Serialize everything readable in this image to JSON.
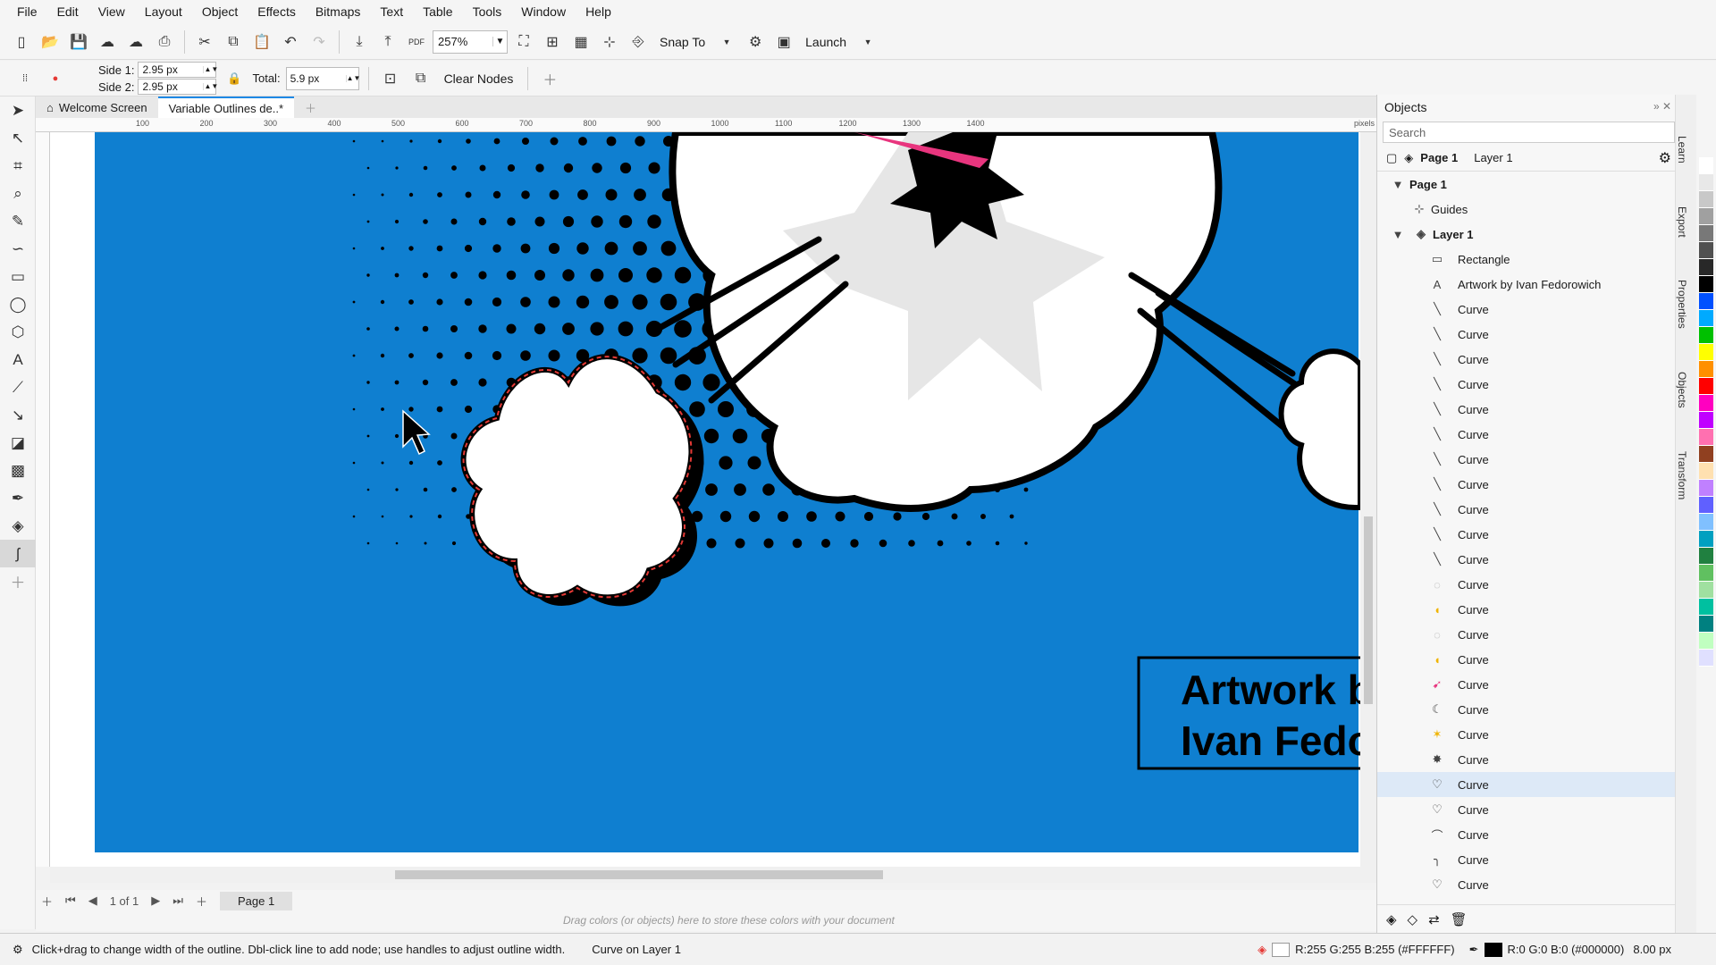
{
  "menu": [
    "File",
    "Edit",
    "View",
    "Layout",
    "Object",
    "Effects",
    "Bitmaps",
    "Text",
    "Table",
    "Tools",
    "Window",
    "Help"
  ],
  "toolbar": {
    "zoom": "257%",
    "snap_to": "Snap To",
    "launch": "Launch"
  },
  "property_bar": {
    "side1_label": "Side 1:",
    "side1_value": "2.95 px",
    "side2_label": "Side 2:",
    "side2_value": "2.95 px",
    "total_label": "Total:",
    "total_value": "5.9 px",
    "clear_nodes": "Clear Nodes"
  },
  "doc_tabs": [
    "Welcome Screen",
    "Variable Outlines de..*"
  ],
  "ruler": {
    "h_ticks": [
      "100",
      "200",
      "300",
      "400",
      "500",
      "600",
      "700",
      "800",
      "900",
      "1000",
      "1100",
      "1200",
      "1300",
      "1400"
    ],
    "units": "pixels"
  },
  "canvas": {
    "artwork_line1": "Artwork by",
    "artwork_line2": "Ivan Fedoro"
  },
  "page_nav": {
    "page_count": "1 of 1",
    "page_tab": "Page 1"
  },
  "color_tray_hint": "Drag colors (or objects) here to store these colors with your document",
  "status": {
    "hint": "Click+drag to change width of the outline. Dbl-click line to add node; use handles to adjust outline width.",
    "selection": "Curve on Layer 1",
    "fill": "R:255 G:255 B:255 (#FFFFFF)",
    "outline": "R:0 G:0 B:0 (#000000)",
    "outline_width": "8.00 px"
  },
  "objects_panel": {
    "title": "Objects",
    "search_placeholder": "Search",
    "page_label": "Page 1",
    "layer_label": "Layer 1",
    "tree_page": "Page 1",
    "guides": "Guides",
    "layer": "Layer 1",
    "items": [
      {
        "icon": "rectangle-icon",
        "label": "Rectangle"
      },
      {
        "icon": "text-icon",
        "label": "Artwork by  Ivan Fedorowich"
      },
      {
        "icon": "curve-line-icon",
        "label": "Curve"
      },
      {
        "icon": "curve-line-icon",
        "label": "Curve"
      },
      {
        "icon": "curve-line-icon",
        "label": "Curve"
      },
      {
        "icon": "curve-line-icon",
        "label": "Curve"
      },
      {
        "icon": "curve-line-icon",
        "label": "Curve"
      },
      {
        "icon": "curve-line-icon",
        "label": "Curve"
      },
      {
        "icon": "curve-line-icon",
        "label": "Curve"
      },
      {
        "icon": "curve-line-icon",
        "label": "Curve"
      },
      {
        "icon": "curve-line-icon",
        "label": "Curve"
      },
      {
        "icon": "curve-line-icon",
        "label": "Curve"
      },
      {
        "icon": "curve-line-icon",
        "label": "Curve"
      },
      {
        "icon": "cloud-outline-icon",
        "label": "Curve"
      },
      {
        "icon": "yellow-shape-icon",
        "label": "Curve"
      },
      {
        "icon": "cloud-outline-icon",
        "label": "Curve"
      },
      {
        "icon": "yellow-shape-icon",
        "label": "Curve"
      },
      {
        "icon": "pink-stroke-icon",
        "label": "Curve"
      },
      {
        "icon": "crescent-icon",
        "label": "Curve"
      },
      {
        "icon": "yellow-star-icon",
        "label": "Curve"
      },
      {
        "icon": "black-star-icon",
        "label": "Curve"
      },
      {
        "icon": "heart-cloud-icon",
        "label": "Curve"
      },
      {
        "icon": "heart-cloud-icon",
        "label": "Curve"
      },
      {
        "icon": "arc-icon",
        "label": "Curve"
      },
      {
        "icon": "hook-icon",
        "label": "Curve"
      },
      {
        "icon": "heart-cloud-icon",
        "label": "Curve"
      }
    ]
  },
  "side_tabs": [
    "Learn",
    "Export",
    "Properties",
    "Objects",
    "Transform"
  ],
  "palette": [
    "#ffffff",
    "#e8e8e8",
    "#c8c8c8",
    "#a0a0a0",
    "#787878",
    "#505050",
    "#282828",
    "#000000",
    "#0050ff",
    "#00aaff",
    "#00c000",
    "#ffff00",
    "#ff9000",
    "#ff0000",
    "#ff00c0",
    "#c000ff",
    "#ff70b0",
    "#904020",
    "#ffe0b0",
    "#c080ff",
    "#6060ff",
    "#80c0ff",
    "#00a0c0",
    "#208040",
    "#60c060",
    "#a0e0a0",
    "#00c0a0",
    "#008080",
    "#c0ffc0",
    "#e0e0ff"
  ]
}
